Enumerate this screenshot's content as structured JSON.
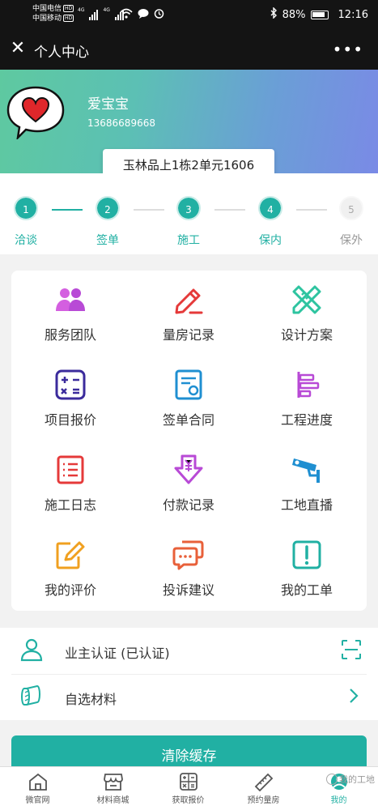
{
  "statusbar": {
    "carrier1": "中国电信",
    "carrier2": "中国移动",
    "hd": "HD",
    "net1": "4G",
    "net2": "4G",
    "battery": "88%",
    "time": "12:16"
  },
  "titlebar": {
    "title": "个人中心"
  },
  "user": {
    "name": "爱宝宝",
    "phone": "13686689668",
    "address": "玉林品上1栋2单元1606"
  },
  "steps": [
    {
      "num": "1",
      "label": "洽谈",
      "active": true
    },
    {
      "num": "2",
      "label": "签单",
      "active": true
    },
    {
      "num": "3",
      "label": "施工",
      "active": true
    },
    {
      "num": "4",
      "label": "保内",
      "active": true
    },
    {
      "num": "5",
      "label": "保外",
      "active": false
    }
  ],
  "grid": [
    {
      "label": "服务团队",
      "icon": "team-icon",
      "color": "#b84ad6"
    },
    {
      "label": "量房记录",
      "icon": "pencil-icon",
      "color": "#e53a3a"
    },
    {
      "label": "设计方案",
      "icon": "ruler-pencil-icon",
      "color": "#2ec4a0"
    },
    {
      "label": "项目报价",
      "icon": "calculator-icon",
      "color": "#3b2b9c"
    },
    {
      "label": "签单合同",
      "icon": "contract-icon",
      "color": "#1f8fd1"
    },
    {
      "label": "工程进度",
      "icon": "gantt-icon",
      "color": "#b84ad6"
    },
    {
      "label": "施工日志",
      "icon": "log-icon",
      "color": "#e53a3a"
    },
    {
      "label": "付款记录",
      "icon": "payment-icon",
      "color": "#b84ad6"
    },
    {
      "label": "工地直播",
      "icon": "camera-icon",
      "color": "#1f8fd1"
    },
    {
      "label": "我的评价",
      "icon": "review-icon",
      "color": "#f0a020"
    },
    {
      "label": "投诉建议",
      "icon": "chat-icon",
      "color": "#e8603a"
    },
    {
      "label": "我的工单",
      "icon": "alert-icon",
      "color": "#21b0a3"
    }
  ],
  "list": {
    "certify": "业主认证 (已认证)",
    "materials": "自选材料"
  },
  "clear_button": "清除缓存",
  "tabs": [
    {
      "label": "微官网"
    },
    {
      "label": "材料商城"
    },
    {
      "label": "获取报价"
    },
    {
      "label": "预约量房"
    },
    {
      "label": "我的"
    }
  ],
  "watermark": "我的工地",
  "colors": {
    "accent": "#21b0a3",
    "dark": "#141414"
  }
}
